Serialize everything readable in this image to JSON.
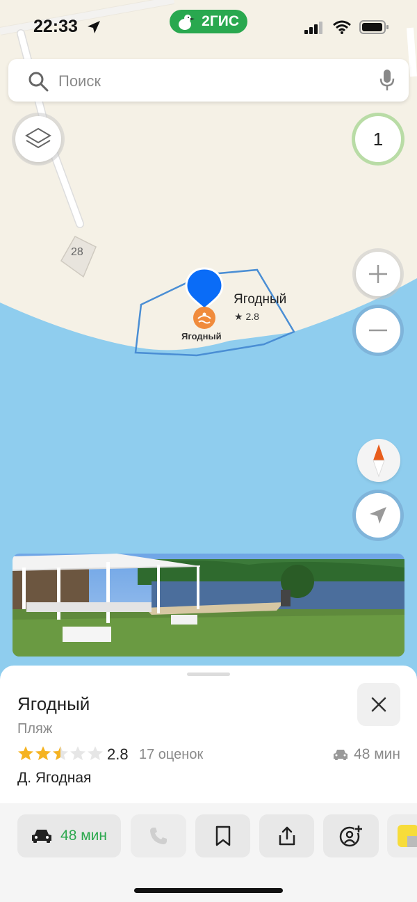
{
  "status_bar": {
    "time": "22:33",
    "brand": "2ГИС"
  },
  "search": {
    "placeholder": "Поиск"
  },
  "map": {
    "counter": "1",
    "building_number": "28",
    "poi": {
      "name": "Ягодный",
      "rating": "★ 2.8",
      "icon_label": "Ягодный"
    }
  },
  "place": {
    "title": "Ягодный",
    "category": "Пляж",
    "rating_value": "2.8",
    "rating_stars": 2.5,
    "rating_count": "17 оценок",
    "drive_time": "48 мин",
    "address": "Д. Ягодная"
  },
  "actions": {
    "route_time": "48 мин"
  },
  "colors": {
    "water": "#8fcdee",
    "land": "#f5f1e6",
    "accent": "#2ca84e",
    "pin": "#0a6cf7",
    "star": "#f5b321"
  },
  "icons": [
    "location-arrow-icon",
    "goose-icon",
    "signal-icon",
    "wifi-icon",
    "battery-icon",
    "search-icon",
    "mic-icon",
    "layers-icon",
    "plus-icon",
    "minus-icon",
    "compass-icon",
    "navigate-icon",
    "car-icon",
    "phone-icon",
    "bookmark-icon",
    "share-icon",
    "add-friend-icon",
    "close-icon"
  ]
}
